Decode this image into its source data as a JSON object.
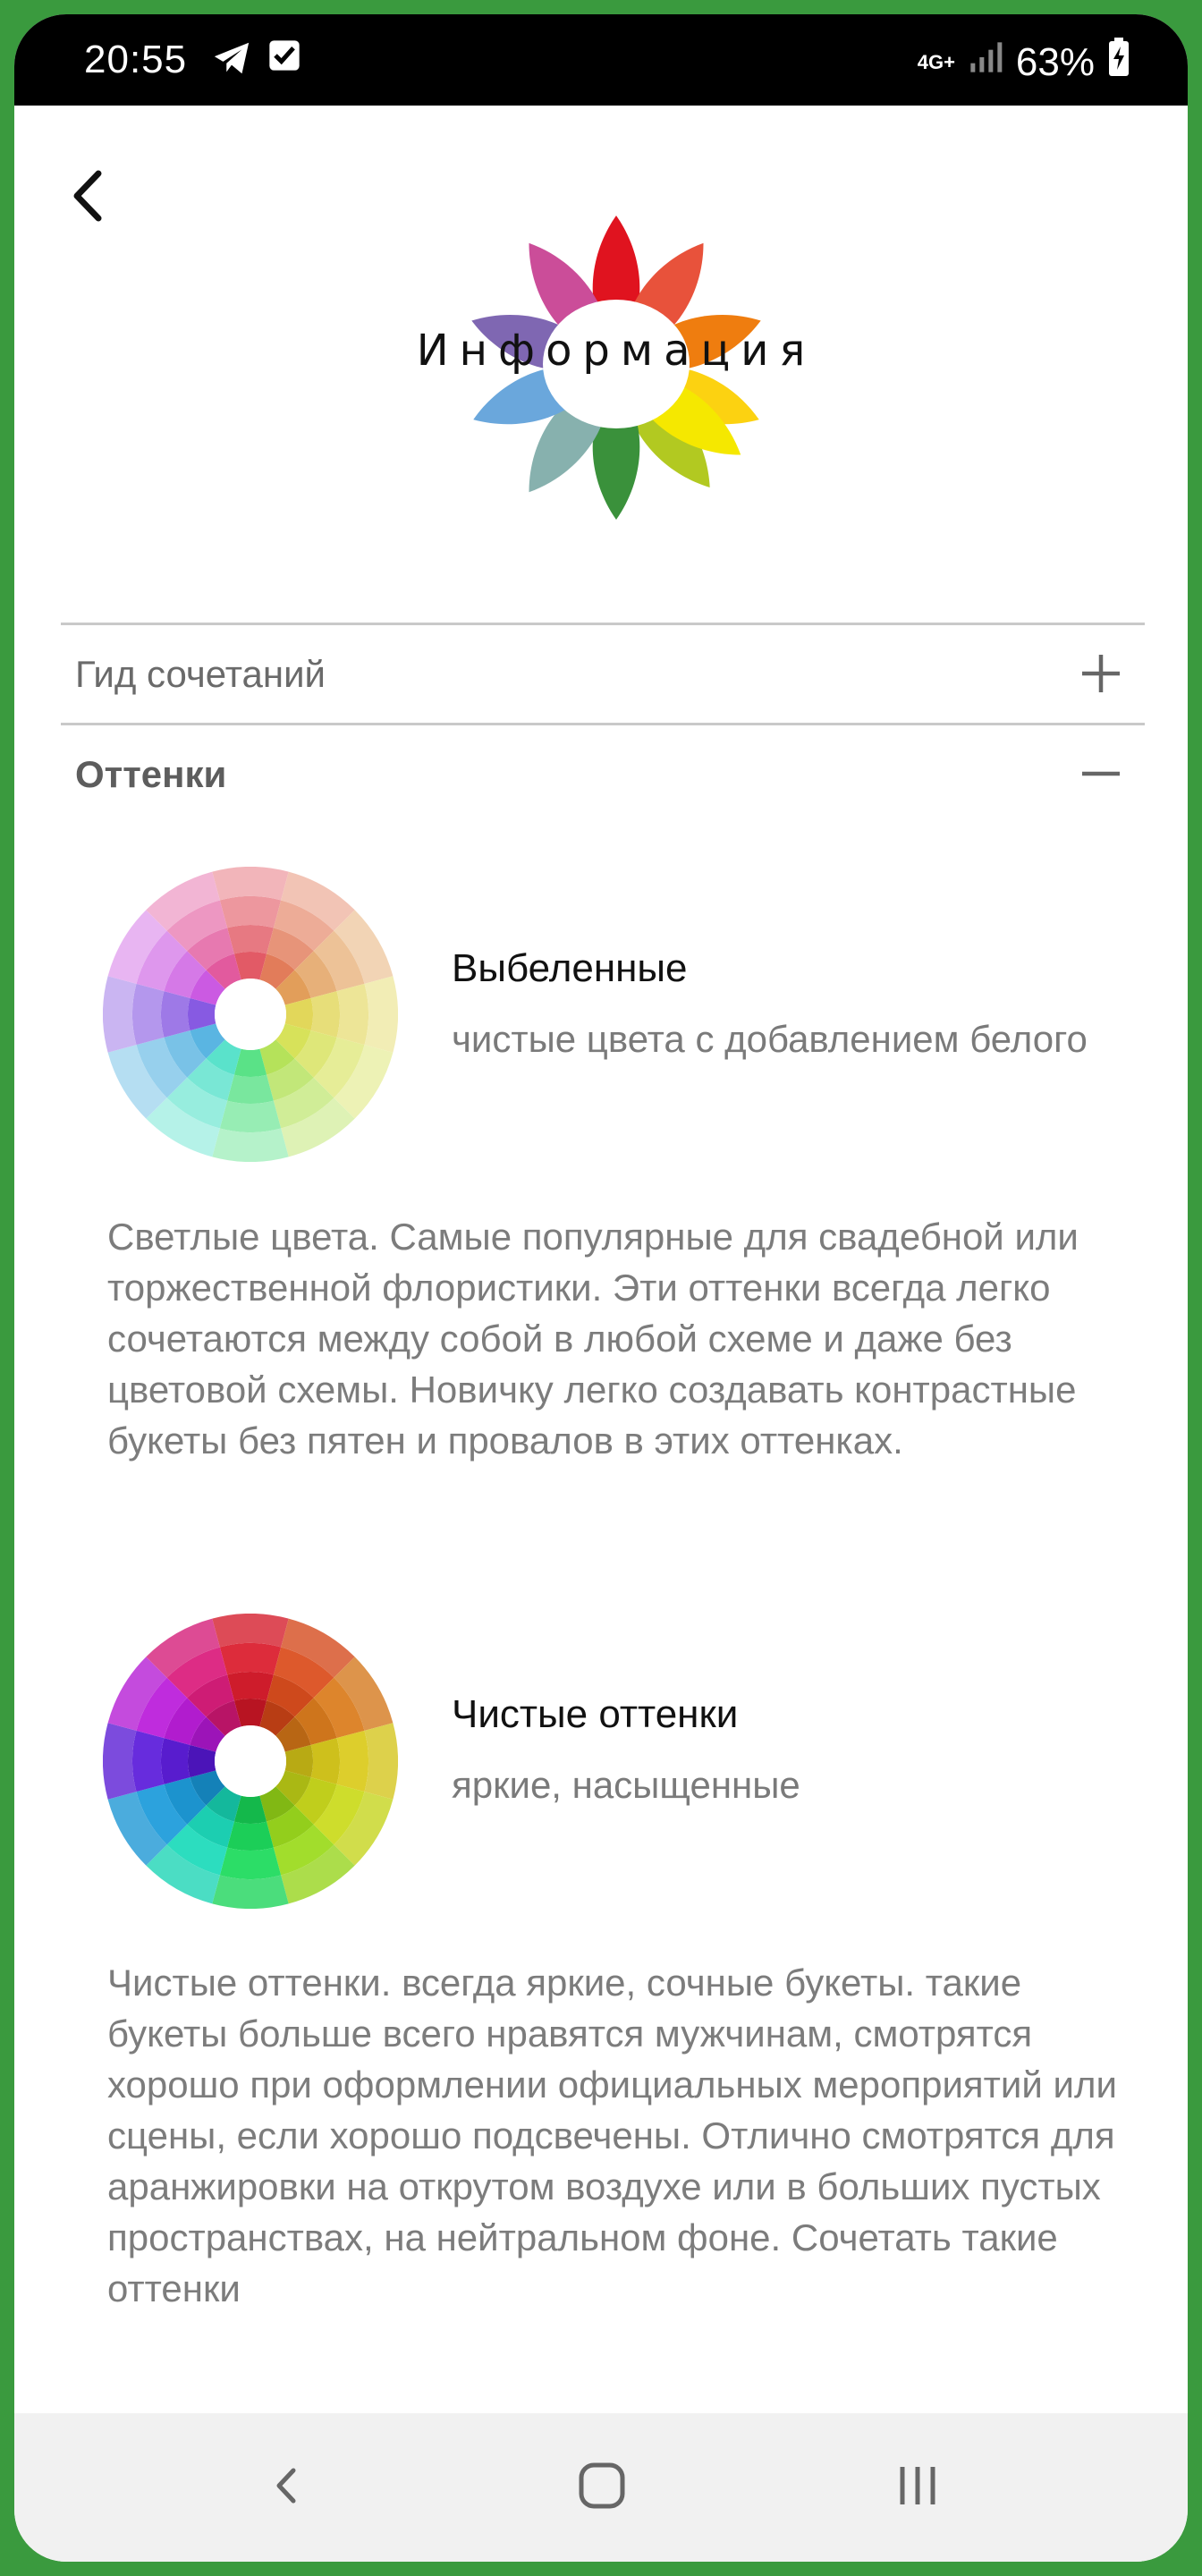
{
  "status_bar": {
    "time": "20:55",
    "network": "4G+",
    "battery": "63%",
    "icons": [
      "telegram-icon",
      "checkbox-notification-icon",
      "signal-icon",
      "battery-charging-icon"
    ]
  },
  "header": {
    "back_icon": "chevron-left-icon",
    "logo_title": "Информация",
    "logo_petal_colors": [
      "#e0131f",
      "#e8523b",
      "#ef7d0f",
      "#fcd211",
      "#f5e800",
      "#b2c921",
      "#3a913b",
      "#87b1ae",
      "#6aa7dc",
      "#7f67b2",
      "#cb4d99"
    ]
  },
  "accordion": [
    {
      "title": "Гид сочетаний",
      "state": "collapsed",
      "icon": "plus-icon"
    },
    {
      "title": "Оттенки",
      "state": "expanded",
      "icon": "minus-icon"
    }
  ],
  "shades": [
    {
      "title": "Выбеленные",
      "subtitle": "чистые цвета с добавлением белого",
      "wheel_style": "tint",
      "description": "Светлые цвета. Самые популярные для свадебной или торжественной флористики. Эти оттенки всегда легко сочетаются между собой в любой схеме и даже без цветовой схемы. Новичку легко создавать контрастные букеты без пятен и провалов в этих оттенках."
    },
    {
      "title": "Чистые оттенки",
      "subtitle": "яркие, насыщенные",
      "wheel_style": "pure",
      "description": "Чистые оттенки. всегда яркие, сочные букеты. такие букеты больше всего нравятся мужчинам, смотрятся хорошо при оформлении официальных мероприятий или сцены, если хорошо подсвечены. Отлично смотрятся для аранжировки на открутом воздухе или в больших пустых пространствах, на нейтральном фоне. Сочетать такие оттенки"
    }
  ],
  "nav_bar": {
    "buttons": [
      "back-nav-icon",
      "home-nav-icon",
      "recents-nav-icon"
    ]
  }
}
